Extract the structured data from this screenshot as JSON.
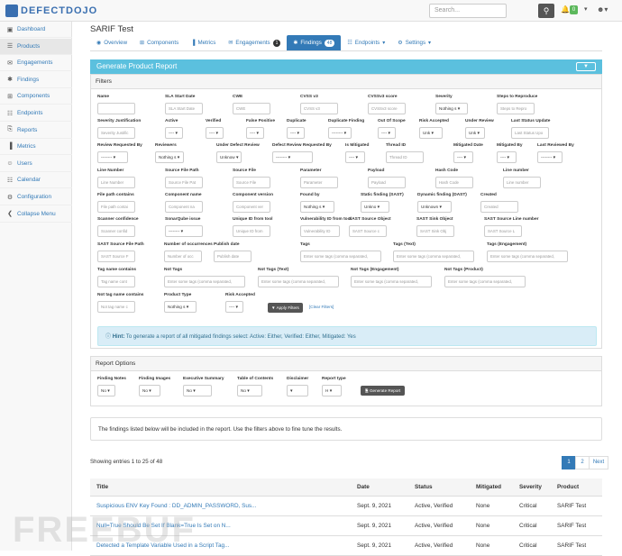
{
  "brand": {
    "name": "DEFECTDOJO"
  },
  "topbar": {
    "search_placeholder": "Search...",
    "notification_count": "0"
  },
  "sidebar": {
    "items": [
      {
        "label": "Dashboard",
        "icon": "dashboard-icon"
      },
      {
        "label": "Products",
        "icon": "list-icon",
        "active": true
      },
      {
        "label": "Engagements",
        "icon": "inbox-icon"
      },
      {
        "label": "Findings",
        "icon": "bug-icon"
      },
      {
        "label": "Components",
        "icon": "table-icon"
      },
      {
        "label": "Endpoints",
        "icon": "sitemap-icon"
      },
      {
        "label": "Reports",
        "icon": "file-icon"
      },
      {
        "label": "Metrics",
        "icon": "bar-chart-icon"
      },
      {
        "label": "Users",
        "icon": "user-icon"
      },
      {
        "label": "Calendar",
        "icon": "calendar-icon"
      },
      {
        "label": "Configuration",
        "icon": "gear-icon"
      },
      {
        "label": "Collapse Menu",
        "icon": "collapse-icon"
      }
    ]
  },
  "page": {
    "title": "SARIF Test"
  },
  "tabs": [
    {
      "label": "Overview"
    },
    {
      "label": "Components"
    },
    {
      "label": "Metrics"
    },
    {
      "label": "Engagements",
      "badge": "1"
    },
    {
      "label": "Findings",
      "badge": "48",
      "active": true
    },
    {
      "label": "Endpoints"
    },
    {
      "label": "Settings"
    }
  ],
  "report": {
    "title": "Generate Product Report",
    "filter_button": "▼"
  },
  "filters": {
    "heading": "Filters",
    "fields": [
      {
        "label": "Name",
        "placeholder": ""
      },
      {
        "label": "SLA Start Date",
        "placeholder": "SLA Start Date"
      },
      {
        "label": "CWE",
        "placeholder": "CWE"
      },
      {
        "label": "CVSS v3",
        "placeholder": "CVSS v3"
      },
      {
        "label": "CVSSv3 score",
        "placeholder": "CVSSv3 score"
      },
      {
        "label": "Severity",
        "select": "Nothing s"
      },
      {
        "label": "Steps to Reproduce",
        "placeholder": "Steps to Repro"
      },
      {
        "label": "Severity Justification",
        "placeholder": "Severity Justific"
      },
      {
        "label": "Active",
        "select": "----"
      },
      {
        "label": "Verified",
        "select": "----"
      },
      {
        "label": "False Positive",
        "select": "----"
      },
      {
        "label": "Duplicate",
        "select": "----"
      },
      {
        "label": "Duplicate Finding",
        "select": "--------"
      },
      {
        "label": "Out Of Scope",
        "select": "----"
      },
      {
        "label": "Risk Accepted",
        "select": "Unk"
      },
      {
        "label": "Under Review",
        "select": "Unk"
      },
      {
        "label": "Last Status Update",
        "placeholder": "Last Status Upo"
      },
      {
        "label": "Review Requested By",
        "select": "--------"
      },
      {
        "label": "Reviewers",
        "select": "Nothing s"
      },
      {
        "label": "Under Defect Review",
        "select": "Unknow"
      },
      {
        "label": "Defect Review Requested By",
        "select": "--------"
      },
      {
        "label": "Is Mitigated",
        "select": "----"
      },
      {
        "label": "Thread ID",
        "placeholder": "Thread ID"
      },
      {
        "label": "Mitigated Date",
        "select": "----"
      },
      {
        "label": "Mitigated By",
        "select": "----"
      },
      {
        "label": "Last Reviewed By",
        "select": "--------"
      },
      {
        "label": "Line Number",
        "placeholder": "Line Number"
      },
      {
        "label": "Source File Path",
        "placeholder": "Source File Pat"
      },
      {
        "label": "Source File",
        "placeholder": "Source File"
      },
      {
        "label": "Parameter",
        "placeholder": "Parameter"
      },
      {
        "label": "Payload",
        "placeholder": "Payload"
      },
      {
        "label": "Hash Code",
        "placeholder": "Hash Code"
      },
      {
        "label": "Line number",
        "placeholder": "Line number"
      },
      {
        "label": "File path contains",
        "placeholder": "File path contai"
      },
      {
        "label": "Component name",
        "placeholder": "Component na"
      },
      {
        "label": "Component version",
        "placeholder": "Component ver"
      },
      {
        "label": "Found by",
        "select": "Nothing s"
      },
      {
        "label": "Static finding (SAST)",
        "select": "Unkno"
      },
      {
        "label": "Dynamic finding (DAST)",
        "select": "Unknown"
      },
      {
        "label": "Created",
        "placeholder": "Created"
      },
      {
        "label": "Scanner confidence",
        "placeholder": "Scanner confid"
      },
      {
        "label": "SonarQube issue",
        "select": "--------"
      },
      {
        "label": "Unique ID from tool",
        "placeholder": "Unique ID from"
      },
      {
        "label": "Vulnerability ID from tool",
        "placeholder": "Vulnerability ID"
      },
      {
        "label": "SAST Source Object",
        "placeholder": "SAST Source c"
      },
      {
        "label": "SAST Sink Object",
        "placeholder": "SAST Sink Obj"
      },
      {
        "label": "SAST Source Line number",
        "placeholder": "SAST Source L"
      },
      {
        "label": "SAST Source File Path",
        "placeholder": "SAST Source F"
      },
      {
        "label": "Number of occurrences",
        "placeholder": "Number of occ"
      },
      {
        "label": "Publish date",
        "placeholder": "Publish date"
      },
      {
        "label": "Tags",
        "placeholder": "Enter some tags (comma separated,"
      },
      {
        "label": "Tags (Text)",
        "placeholder": "Enter some tags (comma separated,"
      },
      {
        "label": "Tags (Engagement)",
        "placeholder": "Enter some tags (comma separated,"
      },
      {
        "label": "Tag name contains",
        "placeholder": "Tag name cont"
      },
      {
        "label": "Not Tags",
        "placeholder": "Enter some tags (comma separated,"
      },
      {
        "label": "Not Tags (Text)",
        "placeholder": "Enter some tags (comma separated,"
      },
      {
        "label": "Not Tags (Engagement)",
        "placeholder": "Enter some tags (comma separated,"
      },
      {
        "label": "Not Tags (Product)",
        "placeholder": "Enter some tags (comma separated,"
      },
      {
        "label": "Not tag name contains",
        "placeholder": "Not tag name c"
      },
      {
        "label": "Product Type",
        "select": "Nothing s"
      },
      {
        "label": "Risk Accepted",
        "select": "----"
      }
    ],
    "apply_label": "Apply Filters",
    "clear_label": "[Clear Filters]"
  },
  "hint": {
    "prefix": "Hint:",
    "text": "To generate a report of all mitigated findings select: Active: Either, Verified: Either, Mitigated: Yes"
  },
  "report_options": {
    "heading": "Report Options",
    "fields": [
      {
        "label": "Finding Notes",
        "select": "No"
      },
      {
        "label": "Finding Images",
        "select": "No"
      },
      {
        "label": "Executive Summary",
        "select": "No"
      },
      {
        "label": "Table of Contents",
        "select": "No"
      },
      {
        "label": "Disclaimer",
        "select": ""
      },
      {
        "label": "Report type",
        "select": "H"
      }
    ],
    "generate_label": "Generate Report"
  },
  "notice": "The findings listed below will be included in the report. Use the filters above to fine tune the results.",
  "showing": "Showing entries 1 to 25 of 48",
  "pagination": {
    "pages": [
      "1",
      "2"
    ],
    "next": "Next"
  },
  "findings_table": {
    "columns": [
      "Title",
      "Date",
      "Status",
      "Mitigated",
      "Severity",
      "Product"
    ],
    "rows": [
      [
        "Suspicious ENV Key Found : DD_ADMIN_PASSWORD, Sus...",
        "Sept. 9, 2021",
        "Active, Verified",
        "None",
        "Critical",
        "SARIF Test"
      ],
      [
        "Null=True Should Be Set If Blank=True Is Set on N...",
        "Sept. 9, 2021",
        "Active, Verified",
        "None",
        "Critical",
        "SARIF Test"
      ],
      [
        "Detected a Template Variable Used in a Script Tag...",
        "Sept. 9, 2021",
        "Active, Verified",
        "None",
        "Critical",
        "SARIF Test"
      ]
    ]
  },
  "watermark": "FREEBUF"
}
